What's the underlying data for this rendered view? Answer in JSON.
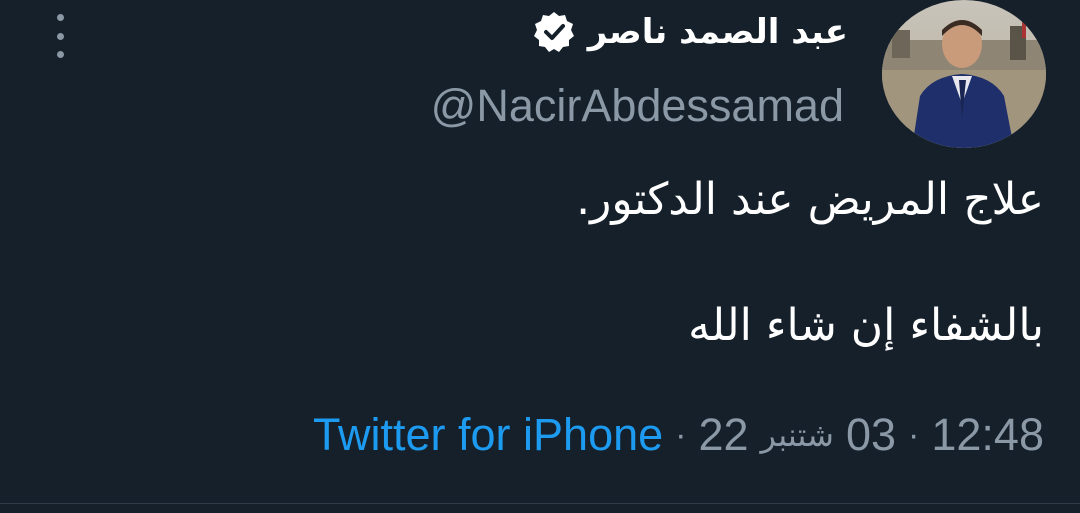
{
  "author": {
    "display_name": "عبد الصمد ناصر",
    "handle": "@NacirAbdessamad",
    "verified": true,
    "avatar_icon": "profile-photo"
  },
  "tweet": {
    "lines": [
      "علاج المريض عند الدكتور.",
      "بالشفاء إن شاء الله"
    ]
  },
  "meta": {
    "time": "12:48",
    "day": "03",
    "month": "شتنبر",
    "year": "22",
    "separator": "·",
    "source": "Twitter for iPhone"
  },
  "colors": {
    "background": "#15202b",
    "text_primary": "#ffffff",
    "text_secondary": "#8b98a5",
    "link": "#1d9bf0"
  },
  "icons": {
    "more": "more-vertical-icon",
    "verified": "verified-badge-icon"
  }
}
